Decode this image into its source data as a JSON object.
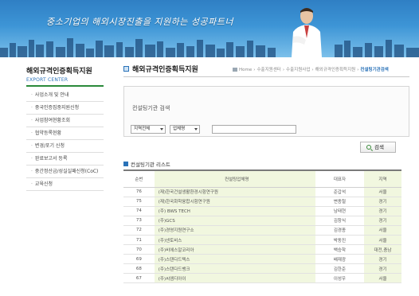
{
  "banner": {
    "slogan": "중소기업의 해외시장진출을 지원하는 성공파트너"
  },
  "sidebar": {
    "title": "해외규격인증획득지원",
    "subtitle": "EXPORT CENTER",
    "items": [
      "사업소개 및 안내",
      "중국인증집중지원신청",
      "사업참여현황조회",
      "협약등록현황",
      "변경/포기 신청",
      "완료보고서 등록",
      "중간정산금/성실실패신청(CoC)",
      "교육신청"
    ]
  },
  "main": {
    "title": "해외규격인증획득지원",
    "breadcrumb": [
      "Home",
      "수출지원센터",
      "수출지원사업",
      "해외규격인증획득지원"
    ],
    "breadcrumb_current": "컨설팅기관검색"
  },
  "search": {
    "heading": "컨설팅기관 검색",
    "region_select": "지역전체",
    "field_select": "업체명",
    "button_label": "검색"
  },
  "list": {
    "title": "컨설팅기관 리스트",
    "columns": [
      "순번",
      "컨설팅업체명",
      "대표자",
      "지역"
    ],
    "rows": [
      {
        "no": "76",
        "name": "(재)한국건설생활환경시험연구원",
        "rep": "준갑석",
        "region": "서울"
      },
      {
        "no": "75",
        "name": "(재)한국화학융합시험연구원",
        "rep": "변종철",
        "region": "경기"
      },
      {
        "no": "74",
        "name": "(주) BWS TECH",
        "rep": "남태현",
        "region": "경기"
      },
      {
        "no": "73",
        "name": "(주)GCS",
        "rep": "김창식",
        "region": "경기"
      },
      {
        "no": "72",
        "name": "(주)경영지원연구소",
        "rep": "김경종",
        "region": "서울"
      },
      {
        "no": "71",
        "name": "(주)넨토비스",
        "rep": "박동진",
        "region": "서울"
      },
      {
        "no": "70",
        "name": "(주)비에스알코리아",
        "rep": "백승학",
        "region": "대전,충남"
      },
      {
        "no": "69",
        "name": "(주)스탠다드텍스",
        "rep": "배재광",
        "region": "경기"
      },
      {
        "no": "68",
        "name": "(주)스탠다드뱅크",
        "rep": "김한준",
        "region": "경기"
      },
      {
        "no": "67",
        "name": "(주)씨엠디아이",
        "rep": "이성우",
        "region": "서울"
      }
    ]
  },
  "colors": {
    "accent_blue": "#2a72b8",
    "accent_green": "#2a8a3a",
    "table_shade": "#f1f7df"
  }
}
